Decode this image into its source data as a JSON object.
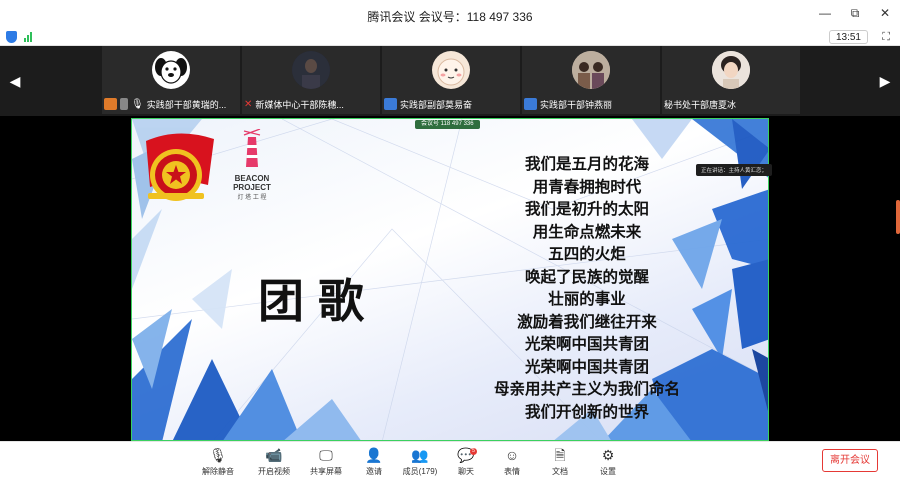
{
  "window": {
    "title": "腾讯会议 会议号：118 497 336",
    "controls": [
      "—",
      "▢",
      "⧉",
      "✕"
    ]
  },
  "status": {
    "time": "13:51",
    "accent": "#2d7be5",
    "signal_color": "#2fbf5a"
  },
  "participants": [
    {
      "name": "实践部干部黄瑞的...",
      "mic_icon": "microphone-icon",
      "avatar": "dog-cartoon"
    },
    {
      "name": "新媒体中心干部陈穗...",
      "mic_icon": "muted-mic-icon",
      "avatar": "dark-photo"
    },
    {
      "name": "实践部副部莫易奋",
      "mic_icon": "user-icon",
      "avatar": "cartoon-face"
    },
    {
      "name": "实践部干部钟燕丽",
      "mic_icon": "user-icon",
      "avatar": "group-photo"
    },
    {
      "name": "秘书处干部唐夏冰",
      "mic_icon": "",
      "avatar": "child-photo"
    }
  ],
  "slide": {
    "share_label": "会议号 118 497 336",
    "title": "团歌",
    "lyrics": [
      "我们是五月的花海",
      "用青春拥抱时代",
      "我们是初升的太阳",
      "用生命点燃未来",
      "五四的火炬",
      "唤起了民族的觉醒",
      "壮丽的事业",
      "激励着我们继往开来",
      "光荣啊中国共青团",
      "光荣啊中国共青团",
      "母亲用共产主义为我们命名",
      "我们开创新的世界"
    ],
    "emblem_text": "中国共青团",
    "beacon_line1": "BEACON",
    "beacon_line2": "PROJECT",
    "beacon_sub": "灯 塔 工 程",
    "speaking": "正在讲话：主持人黄汇恋；"
  },
  "toolbar": {
    "buttons": [
      {
        "label": "解除静音",
        "icon": "muted-mic-icon"
      },
      {
        "label": "开启视频",
        "icon": "video-off-icon"
      },
      {
        "label": "共享屏幕",
        "icon": "share-screen-icon"
      },
      {
        "label": "邀请",
        "icon": "invite-user-icon"
      },
      {
        "label": "成员(179)",
        "icon": "members-icon"
      },
      {
        "label": "聊天",
        "icon": "chat-icon"
      },
      {
        "label": "表情",
        "icon": "emoji-icon"
      },
      {
        "label": "文档",
        "icon": "document-icon"
      },
      {
        "label": "设置",
        "icon": "settings-icon"
      }
    ],
    "chat_badge": "5",
    "leave": "离开会议",
    "leave_color": "#e53935"
  }
}
